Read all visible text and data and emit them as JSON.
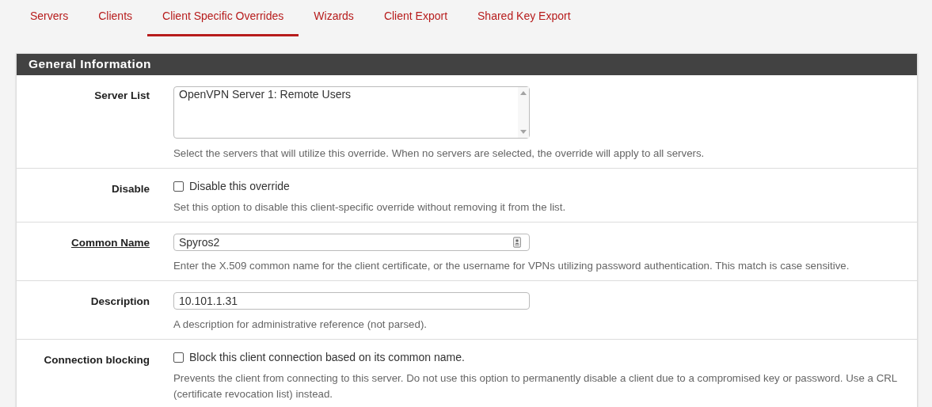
{
  "tabs": [
    {
      "label": "Servers",
      "selected": false
    },
    {
      "label": "Clients",
      "selected": false
    },
    {
      "label": "Client Specific Overrides",
      "selected": true
    },
    {
      "label": "Wizards",
      "selected": false
    },
    {
      "label": "Client Export",
      "selected": false
    },
    {
      "label": "Shared Key Export",
      "selected": false
    }
  ],
  "panel": {
    "title": "General Information",
    "rows": [
      {
        "label": "Server List",
        "label_link": false,
        "kind": "listbox",
        "options": [
          "OpenVPN Server 1: Remote Users"
        ],
        "help": "Select the servers that will utilize this override. When no servers are selected, the override will apply to all servers."
      },
      {
        "label": "Disable",
        "label_link": false,
        "kind": "checkbox",
        "checked": false,
        "text": "Disable this override",
        "help": "Set this option to disable this client-specific override without removing it from the list."
      },
      {
        "label": "Common Name",
        "label_link": true,
        "kind": "text",
        "value": "Spyros2",
        "autofill_icon": true,
        "help": "Enter the X.509 common name for the client certificate, or the username for VPNs utilizing password authentication. This match is case sensitive."
      },
      {
        "label": "Description",
        "label_link": false,
        "kind": "text",
        "value": "10.101.1.31",
        "autofill_icon": false,
        "help": "A description for administrative reference (not parsed)."
      },
      {
        "label": "Connection blocking",
        "label_link": false,
        "kind": "checkbox",
        "checked": false,
        "text": "Block this client connection based on its common name.",
        "help": "Prevents the client from connecting to this server. Do not use this option to permanently disable a client due to a compromised key or password. Use a CRL (certificate revocation list) instead."
      }
    ]
  }
}
